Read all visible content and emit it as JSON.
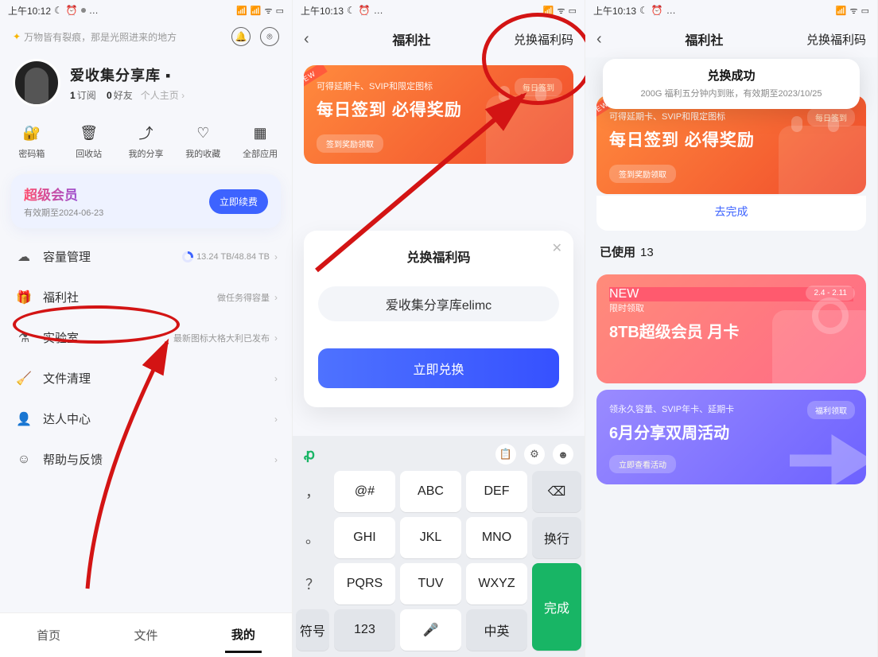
{
  "screen1": {
    "status_time": "上午10:12",
    "slogan": "万物皆有裂痕，那是光照进来的地方",
    "nickname": "爱收集分享库 ▪",
    "stats": {
      "sub_count": "1",
      "sub_label": "订阅",
      "friend_count": "0",
      "friend_label": "好友",
      "role": "个人主页"
    },
    "grid": {
      "a": "密码箱",
      "b": "回收站",
      "c": "我的分享",
      "d": "我的收藏",
      "e": "全部应用"
    },
    "member": {
      "title": "超级会员",
      "expire": "有效期至2024-06-23",
      "btn": "立即续费"
    },
    "rows": {
      "cap": {
        "label": "容量管理",
        "ext": "13.24 TB/48.84 TB"
      },
      "fls": {
        "label": "福利社",
        "ext": "做任务得容量"
      },
      "lab": {
        "label": "实验室",
        "ext": "最新图标大格大利已发布"
      },
      "clean": {
        "label": "文件清理"
      },
      "expert": {
        "label": "达人中心"
      },
      "help": {
        "label": "帮助与反馈"
      }
    },
    "tabs": {
      "home": "首页",
      "files": "文件",
      "mine": "我的"
    }
  },
  "screen2": {
    "status_time": "上午10:13",
    "title": "福利社",
    "action": "兑换福利码",
    "banner": {
      "new": "NEW",
      "sub": "可得延期卡、SVIP和限定图标",
      "main": "每日签到 必得奖励",
      "badge": "每日签到",
      "pill": "签到奖励领取"
    },
    "modal": {
      "title": "兑换福利码",
      "input": "爱收集分享库elimc",
      "btn": "立即兑换"
    },
    "keys": {
      "r1": [
        "@#",
        "ABC",
        "DEF"
      ],
      "r1b": "⌫",
      "r2": [
        "GHI",
        "JKL",
        "MNO"
      ],
      "r2b": "换行",
      "r3": [
        "PQRS",
        "TUV",
        "WXYZ"
      ],
      "r4a": "符号",
      "r4b": "123",
      "r4c": "",
      "r4d": "中英",
      "done": "完成"
    }
  },
  "screen3": {
    "status_time": "上午10:13",
    "title": "福利社",
    "action": "兑换福利码",
    "toast": {
      "t": "兑换成功",
      "s": "200G 福利五分钟内到账，有效期至2023/10/25"
    },
    "banner": {
      "new": "NEW",
      "sub": "可得延期卡、SVIP和限定图标",
      "main": "每日签到 必得奖励",
      "badge": "每日签到",
      "pill": "签到奖励领取"
    },
    "go_done": "去完成",
    "used": {
      "label": "已使用",
      "count": "13"
    },
    "card1": {
      "sub": "限时领取",
      "main": "8TB超级会员 月卡",
      "badge": "2.4 - 2.11"
    },
    "card2": {
      "sub": "领永久容量、SVIP年卡、延期卡",
      "main": "6月分享双周活动",
      "badge": "福利领取",
      "pill": "立即查看活动"
    }
  }
}
